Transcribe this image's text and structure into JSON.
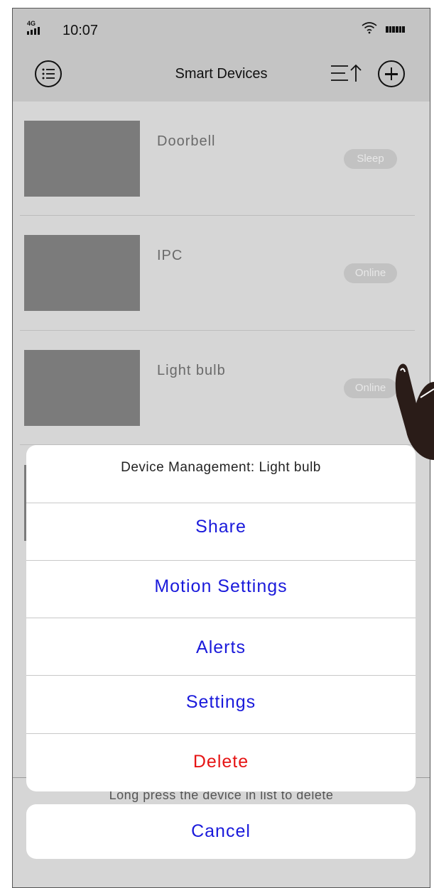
{
  "status_bar": {
    "network_label": "4G",
    "time": "10:07",
    "icons": [
      "signal-icon",
      "wifi-icon",
      "battery-icon"
    ]
  },
  "header": {
    "title": "Smart Devices",
    "icons": [
      "menu-icon",
      "sort-icon",
      "add-icon"
    ]
  },
  "devices": [
    {
      "name": "Doorbell",
      "status": "Sleep"
    },
    {
      "name": "IPC",
      "status": "Online"
    },
    {
      "name": "Light bulb",
      "status": "Online"
    }
  ],
  "hint": "Long press the device in list to delete",
  "action_sheet": {
    "title": "Device Management: Light bulb",
    "items": [
      {
        "label": "Share"
      },
      {
        "label": "Motion Settings"
      },
      {
        "label": "Alerts"
      },
      {
        "label": "Settings"
      },
      {
        "label": "Delete"
      }
    ],
    "cancel_label": "Cancel"
  },
  "colors": {
    "header_bg": "#c4c4c4",
    "list_bg": "#d6d6d6",
    "action_blue": "#1a1adb",
    "delete_red": "#e61414",
    "thumbnail": "#7b7b7b"
  }
}
